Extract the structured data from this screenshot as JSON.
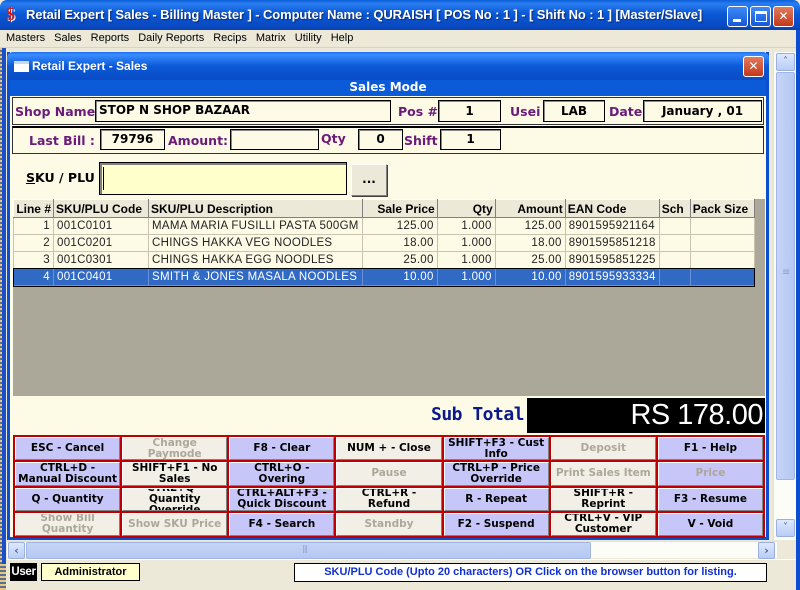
{
  "window": {
    "app_icon": "$",
    "title": "Retail Expert [ Sales - Billing Master ] - Computer Name : QURAISH [ POS No : 1 ] - [ Shift No : 1 ]  [Master/Slave]",
    "minimize_label": "",
    "close_label": "✕"
  },
  "menu": [
    "Masters",
    "Sales",
    "Reports",
    "Daily Reports",
    "Recips",
    "Matrix",
    "Utility",
    "Help"
  ],
  "inner_window": {
    "title": "Retail Expert - Sales",
    "close_label": "✕",
    "mode": "Sales Mode"
  },
  "header": {
    "shop_name_label": "Shop Name",
    "shop_name": "STOP N SHOP BAZAAR",
    "pos_label": "Pos #",
    "pos": "1",
    "user_label": "Usei",
    "user": "LAB",
    "date_label": "Date",
    "date": "January , 01",
    "last_bill_label": "Last Bill :",
    "last_bill": "79796",
    "amount_label": "Amount:",
    "amount": "",
    "qty_label": "Qty",
    "qty": "0",
    "shift_label": "Shift",
    "shift": "1"
  },
  "sku": {
    "label_underlined": "S",
    "label_rest": "KU / PLU :",
    "value": "",
    "browse_label": "..."
  },
  "grid": {
    "columns": [
      "Line #",
      "SKU/PLU Code",
      "SKU/PLU Description",
      "Sale Price",
      "Qty",
      "Amount",
      "EAN Code",
      "Sch",
      "Pack Size"
    ],
    "rows": [
      {
        "line": "1",
        "code": "001C0101",
        "desc": "MAMA MARIA FUSILLI PASTA 500GM",
        "price": "125.00",
        "qty": "1.000",
        "amount": "125.00",
        "ean": "8901595921164",
        "sch": "",
        "pack": ""
      },
      {
        "line": "2",
        "code": "001C0201",
        "desc": "CHINGS HAKKA VEG NOODLES",
        "price": "18.00",
        "qty": "1.000",
        "amount": "18.00",
        "ean": "8901595851218",
        "sch": "",
        "pack": ""
      },
      {
        "line": "3",
        "code": "001C0301",
        "desc": "CHINGS HAKKA EGG NOODLES",
        "price": "25.00",
        "qty": "1.000",
        "amount": "25.00",
        "ean": "8901595851225",
        "sch": "",
        "pack": ""
      },
      {
        "line": "4",
        "code": "001C0401",
        "desc": "SMITH & JONES MASALA NOODLES",
        "price": "10.00",
        "qty": "1.000",
        "amount": "10.00",
        "ean": "8901595933334",
        "sch": "",
        "pack": "",
        "selected": true
      }
    ]
  },
  "subtotal": {
    "label": "Sub Total",
    "value": "RS 178.00"
  },
  "buttons": [
    {
      "label": "ESC - Cancel",
      "style": "blue",
      "enabled": true
    },
    {
      "label": "Change Paymode",
      "style": "grey",
      "enabled": false
    },
    {
      "label": "F8 - Clear",
      "style": "blue",
      "enabled": true
    },
    {
      "label": "NUM + - Close",
      "style": "grey",
      "enabled": true
    },
    {
      "label": "SHIFT+F3 - Cust Info",
      "style": "blue",
      "enabled": true
    },
    {
      "label": "Deposit",
      "style": "grey",
      "enabled": false
    },
    {
      "label": "F1 - Help",
      "style": "blue",
      "enabled": true
    },
    {
      "label": "CTRL+D - Manual Discount",
      "style": "blue",
      "enabled": true
    },
    {
      "label": "SHIFT+F1 - No Sales",
      "style": "grey",
      "enabled": true
    },
    {
      "label": "CTRL+O - Overing",
      "style": "blue",
      "enabled": true
    },
    {
      "label": "Pause",
      "style": "grey",
      "enabled": false
    },
    {
      "label": "CTRL+P - Price Override",
      "style": "blue",
      "enabled": true
    },
    {
      "label": "Print Sales Item",
      "style": "grey",
      "enabled": false
    },
    {
      "label": "Price",
      "style": "blue",
      "enabled": false
    },
    {
      "label": "Q - Quantity",
      "style": "blue",
      "enabled": true
    },
    {
      "label": "CTRL+Q - Quantity Override",
      "style": "grey",
      "enabled": true
    },
    {
      "label": "CTRL+ALT+F3 - Quick Discount",
      "style": "blue",
      "enabled": true
    },
    {
      "label": "CTRL+R - Refund",
      "style": "grey",
      "enabled": true
    },
    {
      "label": "R - Repeat",
      "style": "blue",
      "enabled": true
    },
    {
      "label": "SHIFT+R - Reprint",
      "style": "grey",
      "enabled": true
    },
    {
      "label": "F3 - Resume",
      "style": "blue",
      "enabled": true
    },
    {
      "label": "Show Bill Quantity",
      "style": "grey",
      "enabled": false
    },
    {
      "label": "Show SKU Price",
      "style": "grey",
      "enabled": false
    },
    {
      "label": "F4 - Search",
      "style": "blue",
      "enabled": true
    },
    {
      "label": "Standby",
      "style": "grey",
      "enabled": false
    },
    {
      "label": "F2 - Suspend",
      "style": "blue",
      "enabled": true
    },
    {
      "label": "CTRL+V - VIP Customer",
      "style": "grey",
      "enabled": true
    },
    {
      "label": "V - Void",
      "style": "blue",
      "enabled": true
    }
  ],
  "scroll": {
    "up": "˄",
    "down": "˅",
    "left": "‹",
    "right": "›"
  },
  "status": {
    "user_tag": "User",
    "user": "Administrator",
    "hint": "SKU/PLU Code (Upto 20 characters) OR Click on the browser button for listing."
  },
  "colors": {
    "title_blue": "#0b5ad8",
    "label_purple": "#6b1a7a",
    "button_blue": "#c6c6f8",
    "button_grey": "#f2f0e6",
    "button_border": "#c00000",
    "selected_row": "#316ac5",
    "subtotal_text": "#0a1a8a",
    "hint_text": "#1030d0"
  }
}
